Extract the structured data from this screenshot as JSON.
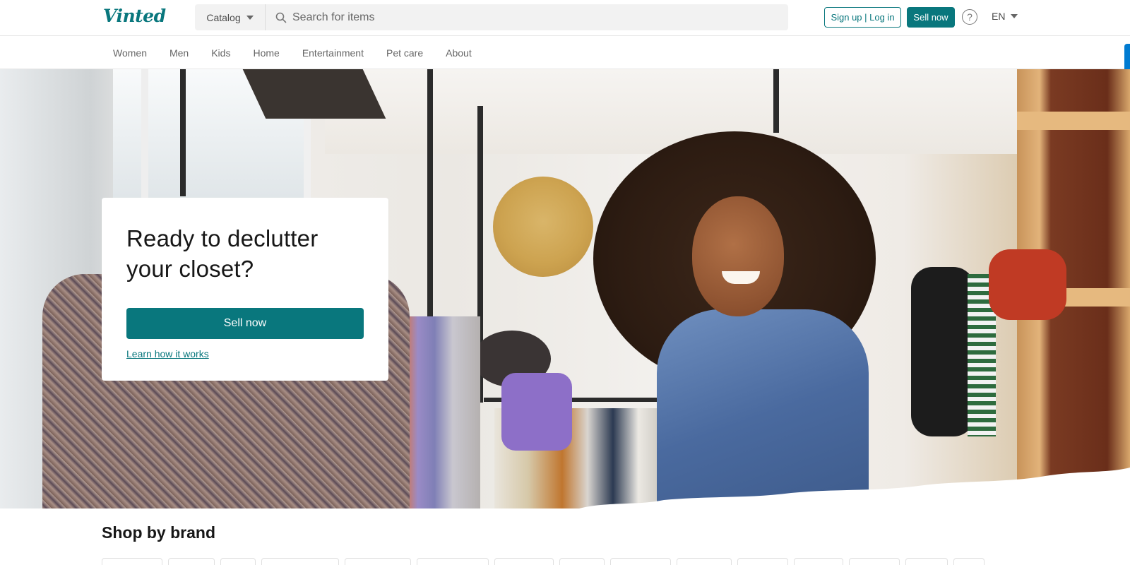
{
  "header": {
    "logo": "Vinted",
    "catalog_label": "Catalog",
    "search_placeholder": "Search for items",
    "signup_login_label": "Sign up | Log in",
    "sell_now_label": "Sell now",
    "help_symbol": "?",
    "language": "EN"
  },
  "nav": {
    "items": [
      "Women",
      "Men",
      "Kids",
      "Home",
      "Entertainment",
      "Pet care",
      "About"
    ]
  },
  "hero": {
    "title": "Ready to declutter your closet?",
    "sell_now_label": "Sell now",
    "learn_link": "Learn how it works"
  },
  "brands": {
    "title": "Shop by brand"
  },
  "icons": {
    "search": "search-icon",
    "catalog_caret": "chevron-down-icon",
    "help": "help-icon",
    "language_caret": "chevron-down-icon"
  },
  "colors": {
    "brand": "#09777d",
    "edge_tab": "#007bd1"
  }
}
